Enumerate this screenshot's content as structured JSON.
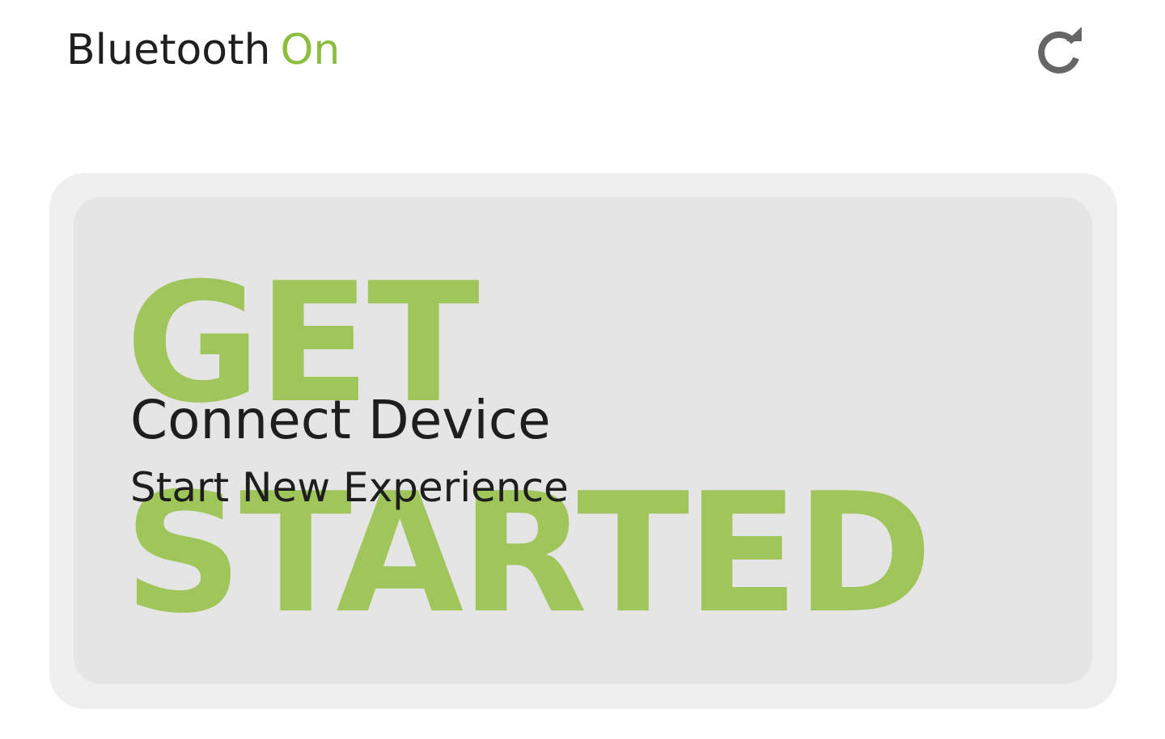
{
  "header": {
    "label": "Bluetooth",
    "state": "On",
    "refresh_icon": "refresh-icon"
  },
  "card": {
    "bg_word_1": "GET",
    "bg_word_2": "STARTED",
    "title": "Connect Device",
    "subtitle": "Start New Experience"
  },
  "colors": {
    "accent": "#8bbd3f",
    "bg_word": "#a0c55a",
    "text": "#1f1f1f",
    "icon": "#666666",
    "card_outer": "#efefef",
    "card_inner": "#e5e5e5"
  }
}
